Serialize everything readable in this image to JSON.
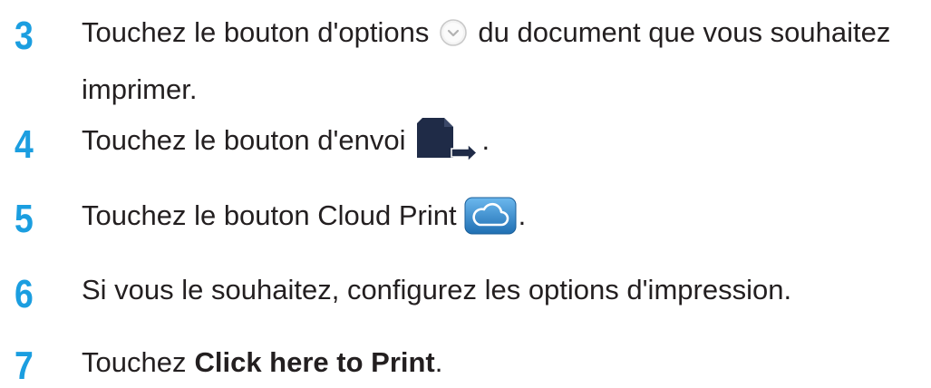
{
  "steps": [
    {
      "number": "3",
      "text_before": "Touchez le bouton d'options",
      "icon": "options-icon",
      "text_after": "du document que vous souhaitez",
      "line2": "imprimer."
    },
    {
      "number": "4",
      "text_before": "Touchez le bouton d'envoi",
      "icon": "send-icon",
      "text_after": "."
    },
    {
      "number": "5",
      "text_before": "Touchez le bouton Cloud Print",
      "icon": "cloud-print-icon",
      "text_after": "."
    },
    {
      "number": "6",
      "text": "Si vous le souhaitez, configurez les options d'impression."
    },
    {
      "number": "7",
      "text_before": "Touchez",
      "bold": "Click here to Print",
      "text_after": "."
    }
  ],
  "colors": {
    "step_number": "#1b9ee0",
    "text": "#231f20",
    "send_icon": "#1f2b47",
    "cloud_icon": "#2a7fc0"
  }
}
